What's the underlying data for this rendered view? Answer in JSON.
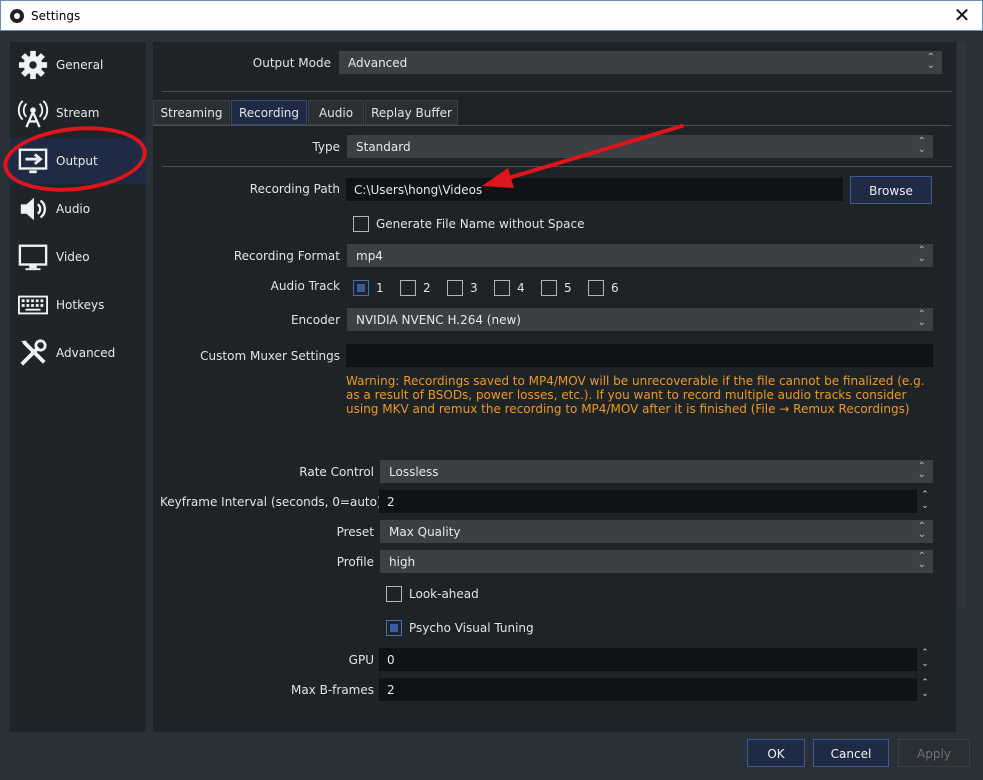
{
  "window": {
    "title": "Settings",
    "close_glyph": "✕",
    "app_icon": "obs-icon"
  },
  "sidebar": {
    "items": [
      {
        "label": "General",
        "icon": "gear-icon"
      },
      {
        "label": "Stream",
        "icon": "antenna-icon"
      },
      {
        "label": "Output",
        "icon": "output-icon",
        "active": true
      },
      {
        "label": "Audio",
        "icon": "speaker-icon"
      },
      {
        "label": "Video",
        "icon": "monitor-icon"
      },
      {
        "label": "Hotkeys",
        "icon": "keyboard-icon"
      },
      {
        "label": "Advanced",
        "icon": "tools-icon"
      }
    ]
  },
  "output": {
    "mode_label": "Output Mode",
    "mode_value": "Advanced",
    "tabs": [
      "Streaming",
      "Recording",
      "Audio",
      "Replay Buffer"
    ],
    "active_tab": "Recording",
    "type_label": "Type",
    "type_value": "Standard",
    "path_label": "Recording Path",
    "path_value": "C:\\Users\\hong\\Videos",
    "browse_label": "Browse",
    "gen_filename_label": "Generate File Name without Space",
    "format_label": "Recording Format",
    "format_value": "mp4",
    "audio_track_label": "Audio Track",
    "tracks": [
      "1",
      "2",
      "3",
      "4",
      "5",
      "6"
    ],
    "tracks_checked": [
      true,
      false,
      false,
      false,
      false,
      false
    ],
    "encoder_label": "Encoder",
    "encoder_value": "NVIDIA NVENC H.264 (new)",
    "muxer_label": "Custom Muxer Settings",
    "muxer_value": "",
    "warning": "Warning: Recordings saved to MP4/MOV will be unrecoverable if the file cannot be finalized (e.g. as a result of BSODs, power losses, etc.). If you want to record multiple audio tracks consider using MKV and remux the recording to MP4/MOV after it is finished (File → Remux Recordings)",
    "rate_control_label": "Rate Control",
    "rate_control_value": "Lossless",
    "keyframe_label": "Keyframe Interval (seconds, 0=auto)",
    "keyframe_value": "2",
    "preset_label": "Preset",
    "preset_value": "Max Quality",
    "profile_label": "Profile",
    "profile_value": "high",
    "lookahead_label": "Look-ahead",
    "lookahead_checked": false,
    "psycho_label": "Psycho Visual Tuning",
    "psycho_checked": true,
    "gpu_label": "GPU",
    "gpu_value": "0",
    "bframes_label": "Max B-frames",
    "bframes_value": "2"
  },
  "footer": {
    "ok": "OK",
    "cancel": "Cancel",
    "apply": "Apply"
  },
  "colors": {
    "accent": "#3f5a97",
    "warning": "#ee9a1f",
    "annotation": "#e0151b"
  }
}
